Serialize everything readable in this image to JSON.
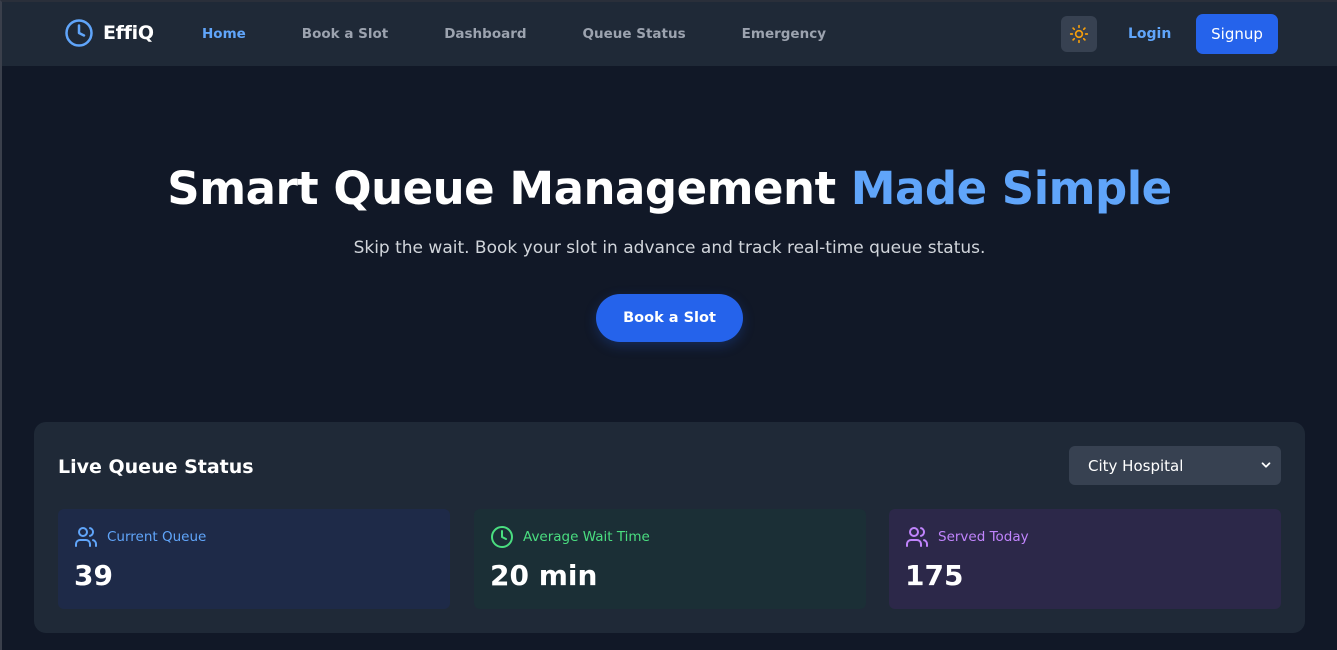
{
  "colors": {
    "background": "#111827",
    "navbar": "#1f2937",
    "accent": "#60a5fa",
    "primary_button": "#2563eb",
    "sun_icon": "#f59e0b",
    "stat_blue": "#60a5fa",
    "stat_green": "#4ade80",
    "stat_purple": "#c084fc"
  },
  "navbar": {
    "brand": "EffiQ",
    "brand_icon": "clock-icon",
    "links": [
      {
        "label": "Home",
        "active": true
      },
      {
        "label": "Book a Slot",
        "active": false
      },
      {
        "label": "Dashboard",
        "active": false
      },
      {
        "label": "Queue Status",
        "active": false
      },
      {
        "label": "Emergency",
        "active": false
      }
    ],
    "theme_toggle_icon": "sun-icon",
    "login_label": "Login",
    "signup_label": "Signup"
  },
  "hero": {
    "title_main": "Smart Queue Management",
    "title_accent": "Made Simple",
    "subtitle": "Skip the wait. Book your slot in advance and track real-time queue status.",
    "cta_label": "Book a Slot"
  },
  "live_queue": {
    "title": "Live Queue Status",
    "location_selected": "City Hospital",
    "stats": [
      {
        "label": "Current Queue",
        "value": "39",
        "icon": "users-icon"
      },
      {
        "label": "Average Wait Time",
        "value": "20 min",
        "icon": "clock-icon"
      },
      {
        "label": "Served Today",
        "value": "175",
        "icon": "users-icon"
      }
    ]
  }
}
